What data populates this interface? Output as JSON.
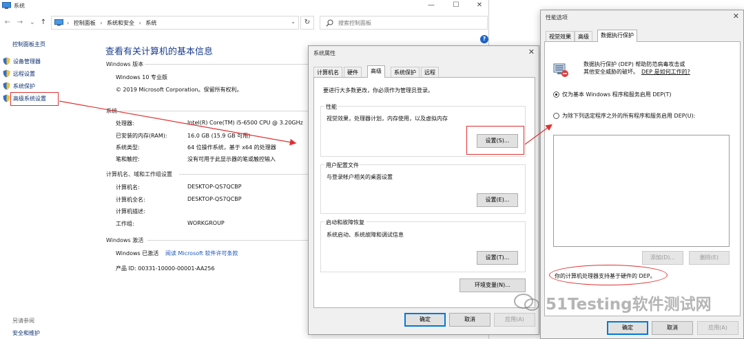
{
  "system_window": {
    "title": "系统",
    "controls": {
      "minimize": "—",
      "maximize": "☐",
      "close": "✕"
    },
    "breadcrumbs": [
      "控制面板",
      "系统和安全",
      "系统"
    ],
    "search_placeholder": "搜索控制面板",
    "left_nav": {
      "home": "控制面板主页",
      "links": [
        "设备管理器",
        "远程设置",
        "系统保护",
        "高级系统设置"
      ],
      "see_also": "另请参阅",
      "see_also_link": "安全和维护"
    },
    "page_title": "查看有关计算机的基本信息",
    "windows_edition": {
      "heading": "Windows 版本",
      "edition": "Windows 10 专业版",
      "copyright": "© 2019 Microsoft Corporation。保留所有权利。"
    },
    "system": {
      "heading": "系统",
      "rows": [
        {
          "label": "处理器:",
          "value": "Intel(R) Core(TM) i5-6500 CPU @ 3.20GHz"
        },
        {
          "label": "已安装的内存(RAM):",
          "value": "16.0 GB (15.9 GB 可用)"
        },
        {
          "label": "系统类型:",
          "value": "64 位操作系统，基于 x64 的处理器"
        },
        {
          "label": "笔和触控:",
          "value": "没有可用于此显示器的笔或触控输入"
        }
      ]
    },
    "computer": {
      "heading": "计算机名、域和工作组设置",
      "rows": [
        {
          "label": "计算机名:",
          "value": "DESKTOP-QS7QCBP"
        },
        {
          "label": "计算机全名:",
          "value": "DESKTOP-QS7QCBP"
        },
        {
          "label": "计算机描述:",
          "value": ""
        },
        {
          "label": "工作组:",
          "value": "WORKGROUP"
        }
      ]
    },
    "activation": {
      "heading": "Windows 激活",
      "status": "Windows 已激活",
      "license_link": "阅读 Microsoft 软件许可条款",
      "product_id": "产品 ID: 00331-10000-00001-AA256"
    }
  },
  "props_dialog": {
    "title": "系统属性",
    "tabs": [
      "计算机名",
      "硬件",
      "高级",
      "系统保护",
      "远程"
    ],
    "active_tab": "高级",
    "admin_note": "要进行大多数更改，你必须作为管理员登录。",
    "performance": {
      "title": "性能",
      "desc": "视觉效果，处理器计划，内存使用，以及虚拟内存",
      "button": "设置(S)..."
    },
    "user_profiles": {
      "title": "用户配置文件",
      "desc": "与登录帐户相关的桌面设置",
      "button": "设置(E)..."
    },
    "startup": {
      "title": "启动和故障恢复",
      "desc": "系统启动、系统故障和调试信息",
      "button": "设置(T)..."
    },
    "env_button": "环境变量(N)...",
    "ok": "确定",
    "cancel": "取消",
    "apply": "应用(A)"
  },
  "perf_dialog": {
    "title": "性能选项",
    "tabs": [
      "视觉效果",
      "高级",
      "数据执行保护"
    ],
    "active_tab": "数据执行保护",
    "desc_line1": "数据执行保护 (DEP) 帮助防范病毒攻击或",
    "desc_line2": "其他安全威胁的破坏。",
    "how_link": "DEP 是如何工作的?",
    "option1": "仅为基本 Windows 程序和服务启用 DEP(T)",
    "option2": "为除下列选定程序之外的所有程序和服务启用 DEP(U):",
    "selected_option": 1,
    "add_button": "添加(D)...",
    "remove_button": "删除(E)",
    "hardware_note": "你的计算机处理器支持基于硬件的 DEP。",
    "ok": "确定",
    "cancel": "取消",
    "apply": "应用(A)"
  },
  "watermark": "51Testing软件测试网",
  "colors": {
    "annotation": "#e03030",
    "link": "#1a56c0",
    "title_blue": "#1a3d8f"
  }
}
